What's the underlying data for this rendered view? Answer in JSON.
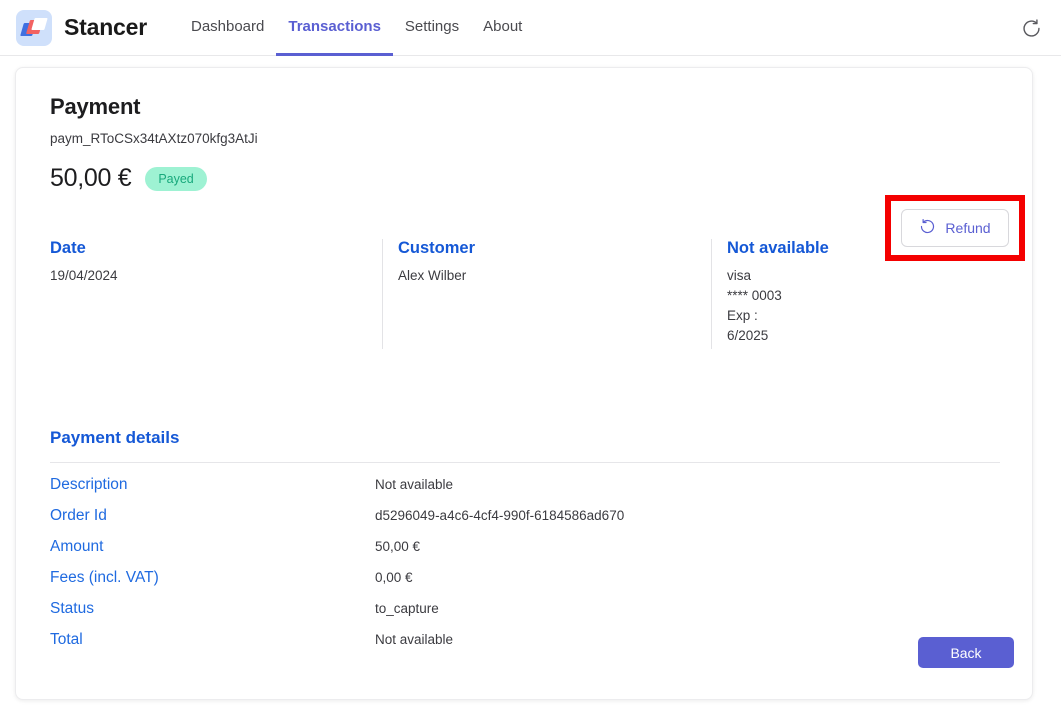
{
  "header": {
    "brand_name": "Stancer",
    "logo_icon": "stancer-logo-icon",
    "nav": [
      {
        "label": "Dashboard",
        "active": false
      },
      {
        "label": "Transactions",
        "active": true
      },
      {
        "label": "Settings",
        "active": false
      },
      {
        "label": "About",
        "active": false
      }
    ],
    "refresh_icon": "refresh-icon"
  },
  "payment": {
    "title": "Payment",
    "id": "paym_RToCSx34tAXtz070kfg3AtJi",
    "amount": "50,00 €",
    "status_badge": "Payed",
    "refund_label": "Refund",
    "refund_icon": "rotate-left-icon"
  },
  "info_columns": [
    {
      "title": "Date",
      "lines": [
        "19/04/2024"
      ]
    },
    {
      "title": "Customer",
      "lines": [
        "Alex Wilber"
      ]
    },
    {
      "title": "Not available",
      "lines": [
        "visa",
        "**** 0003",
        "Exp :",
        "6/2025"
      ]
    }
  ],
  "details": {
    "title": "Payment details",
    "rows": [
      {
        "label": "Description",
        "value": "Not available"
      },
      {
        "label": "Order Id",
        "value": "d5296049-a4c6-4cf4-990f-6184586ad670"
      },
      {
        "label": "Amount",
        "value": "50,00 €"
      },
      {
        "label": "Fees (incl. VAT)",
        "value": "0,00 €"
      },
      {
        "label": "Status",
        "value": "to_capture"
      },
      {
        "label": "Total",
        "value": "Not available"
      }
    ]
  },
  "footer": {
    "back_label": "Back"
  },
  "colors": {
    "accent_indigo": "#5a5fd2",
    "link_blue": "#1558d6",
    "badge_bg": "#9ef2d3",
    "badge_text": "#18a97c",
    "highlight_red": "#f40000"
  }
}
